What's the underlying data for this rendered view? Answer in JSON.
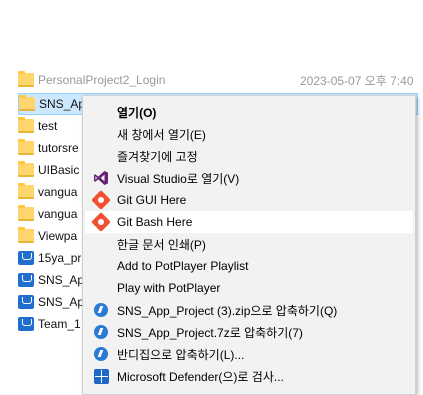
{
  "file_list": {
    "partial_row": {
      "name": "PersonalProject2_Login",
      "date": "2023-05-07 오후 7:40"
    },
    "rows": [
      {
        "name": "SNS_Ap",
        "type": "folder",
        "selected": true
      },
      {
        "name": "test",
        "type": "folder"
      },
      {
        "name": "tutorsre",
        "type": "folder"
      },
      {
        "name": "UIBasic",
        "type": "folder"
      },
      {
        "name": "vangua",
        "type": "folder"
      },
      {
        "name": "vangua",
        "type": "folder"
      },
      {
        "name": "Viewpa",
        "type": "folder"
      },
      {
        "name": "15ya_pr",
        "type": "zip"
      },
      {
        "name": "SNS_Ap",
        "type": "zip"
      },
      {
        "name": "SNS_Ap",
        "type": "zip"
      },
      {
        "name": "Team_1",
        "type": "zip"
      }
    ]
  },
  "context_menu": {
    "items": [
      {
        "label": "열기(O)",
        "icon": "none",
        "bold": true
      },
      {
        "label": "새 창에서 열기(E)",
        "icon": "none"
      },
      {
        "label": "즐겨찾기에 고정",
        "icon": "none"
      },
      {
        "label": "Visual Studio로 열기(V)",
        "icon": "visual-studio-icon"
      },
      {
        "label": "Git GUI Here",
        "icon": "git-icon"
      },
      {
        "label": "Git Bash Here",
        "icon": "git-icon",
        "hovered": true
      },
      {
        "label": "한글 문서 인쇄(P)",
        "icon": "none"
      },
      {
        "label": "Add to PotPlayer Playlist",
        "icon": "none"
      },
      {
        "label": "Play with PotPlayer",
        "icon": "none"
      },
      {
        "label": "SNS_App_Project (3).zip으로 압축하기(Q)",
        "icon": "bandizip-icon"
      },
      {
        "label": "SNS_App_Project.7z로 압축하기(7)",
        "icon": "bandizip-icon"
      },
      {
        "label": "반디집으로 압축하기(L)...",
        "icon": "bandizip-icon"
      },
      {
        "label": "Microsoft Defender(으)로 검사...",
        "icon": "defender-icon"
      }
    ]
  },
  "colors": {
    "selection_bg": "#cce8ff",
    "menu_bg": "#f2f2f2",
    "hover_bg": "#ffffff",
    "folder": "#ffd66e",
    "git": "#f05133",
    "vs_purple": "#68217a"
  }
}
